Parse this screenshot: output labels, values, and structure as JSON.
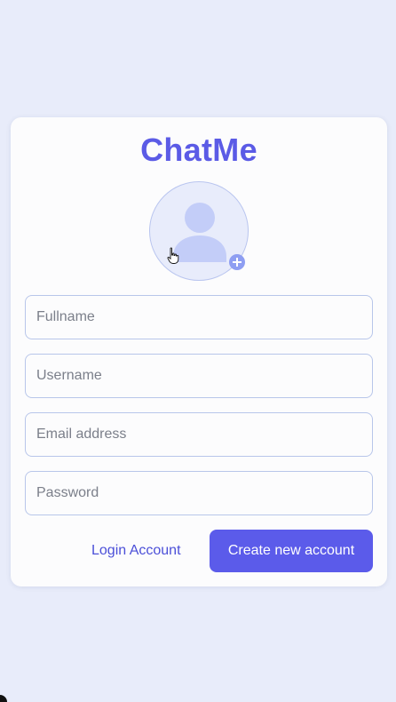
{
  "app": {
    "title": "ChatMe"
  },
  "avatar": {
    "icon": "user-silhouette-icon",
    "add_icon": "plus-circle-icon"
  },
  "form": {
    "fullname": {
      "placeholder": "Fullname",
      "value": ""
    },
    "username": {
      "placeholder": "Username",
      "value": ""
    },
    "email": {
      "placeholder": "Email address",
      "value": ""
    },
    "password": {
      "placeholder": "Password",
      "value": ""
    }
  },
  "actions": {
    "login_label": "Login Account",
    "create_label": "Create new account"
  },
  "colors": {
    "background": "#e8ecfa",
    "card": "#fcfcfd",
    "accent": "#5b5bea",
    "title": "#5b5be6",
    "avatar_fill": "#c3cdf8",
    "input_border": "#b8c6ea"
  }
}
